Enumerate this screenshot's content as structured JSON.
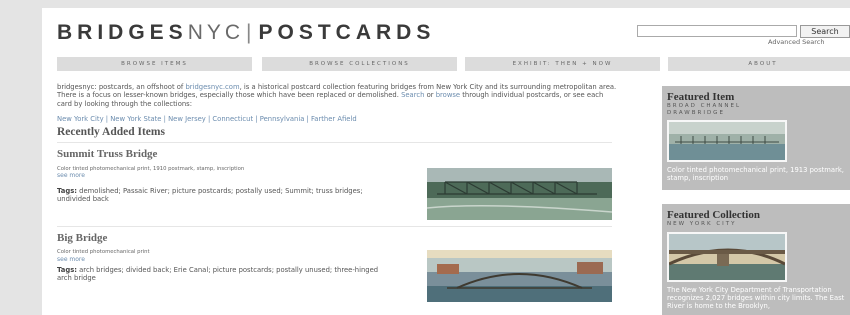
{
  "header": {
    "logo_part1": "BRIDGES",
    "logo_part2": "NYC",
    "logo_sep": "|",
    "logo_part3": "POSTCARDS",
    "search_button": "Search",
    "advanced_search": "Advanced Search"
  },
  "nav": {
    "items": [
      "BROWSE ITEMS",
      "BROWSE COLLECTIONS",
      "EXHIBIT: THEN + NOW",
      "ABOUT"
    ]
  },
  "intro": {
    "text1": "bridgesnyc: postcards, an offshoot of ",
    "link1": "bridgesnyc.com",
    "text2": ", is a historical postcard collection featuring bridges from New York City and its surrounding metropolitan area. There is a focus on lesser-known bridges, especially those which have been replaced or demolished. ",
    "link2": "Search",
    "text3": " or ",
    "link3": "browse",
    "text4": " through individual postcards, or see each card by looking through the collections:",
    "collections": "New York City | New York State | New Jersey | Connecticut | Pennsylvania | Farther Afield"
  },
  "recent": {
    "heading": "Recently Added Items",
    "items": [
      {
        "title": "Summit Truss Bridge",
        "description": "Color tinted photomechanical print, 1910 postmark, stamp, inscription",
        "see_more": "see more",
        "tags_label": "Tags:",
        "tags": " demolished; Passaic River; picture postcards; postally used; Summit; truss bridges; undivided back"
      },
      {
        "title": "Big Bridge",
        "description": "Color tinted photomechanical print",
        "see_more": "see more",
        "tags_label": "Tags:",
        "tags": " arch bridges; divided back; Erie Canal; picture postcards; postally unused; three-hinged arch bridge"
      }
    ]
  },
  "sidebar": {
    "featured_item": {
      "title": "Featured Item",
      "subtitle_line1": "BROAD CHANNEL",
      "subtitle_line2": "DRAWBRIDGE",
      "text": "Color tinted photomechanical print, 1913 postmark, stamp, inscription"
    },
    "featured_collection": {
      "title": "Featured Collection",
      "subtitle": "NEW YORK CITY",
      "text": "The New York City Department of Transportation recognizes 2,027 bridges within city limits. The East River is home to the Brooklyn,"
    }
  },
  "colors": {
    "background": "#e4e4e4",
    "page": "#ffffff",
    "nav": "#dcdcdc",
    "link": "#6b8cae",
    "sidebar": "#bdbdbd"
  }
}
